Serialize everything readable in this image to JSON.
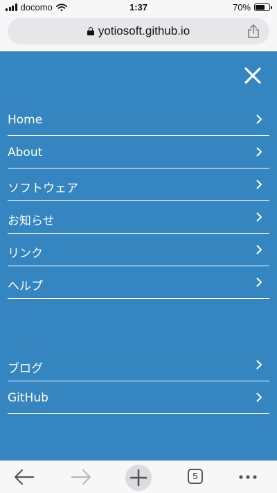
{
  "status_bar": {
    "carrier": "docomo",
    "time": "1:37",
    "battery_text": "70%",
    "battery_level": 0.7
  },
  "address_bar": {
    "url": "yotiosoft.github.io"
  },
  "menu": {
    "primary_items": [
      {
        "label": "Home"
      },
      {
        "label": "About"
      },
      {
        "label": "ソフトウェア"
      },
      {
        "label": "お知らせ"
      },
      {
        "label": "リンク"
      },
      {
        "label": "ヘルプ"
      }
    ],
    "secondary_items": [
      {
        "label": "ブログ"
      },
      {
        "label": "GitHub"
      }
    ]
  },
  "toolbar": {
    "tabs_count": "5"
  },
  "colors": {
    "menu_background": "#3585c0",
    "chrome_background": "#f7f7f7",
    "disabled_icon": "#b9b9b9"
  }
}
